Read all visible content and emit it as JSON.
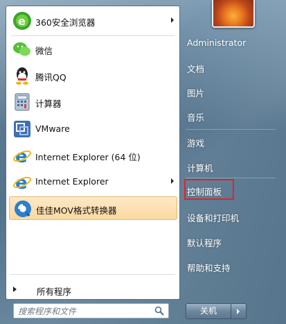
{
  "programs": [
    {
      "label": "360安全浏览器",
      "icon": "360-browser-icon",
      "has_submenu": true
    },
    {
      "label": "微信",
      "icon": "wechat-icon",
      "has_submenu": false
    },
    {
      "label": "腾讯QQ",
      "icon": "qq-icon",
      "has_submenu": false
    },
    {
      "label": "计算器",
      "icon": "calculator-icon",
      "has_submenu": false
    },
    {
      "label": "VMware",
      "icon": "vmware-icon",
      "has_submenu": false
    },
    {
      "label": "Internet Explorer (64 位)",
      "icon": "ie-icon",
      "has_submenu": false
    },
    {
      "label": "Internet Explorer",
      "icon": "ie-icon",
      "has_submenu": true
    },
    {
      "label": "佳佳MOV格式转换器",
      "icon": "mov-converter-icon",
      "has_submenu": false,
      "highlighted": true
    }
  ],
  "all_programs": "所有程序",
  "search": {
    "placeholder": "搜索程序和文件"
  },
  "right": {
    "user": "Administrator",
    "documents": "文档",
    "pictures": "图片",
    "music": "音乐",
    "games": "游戏",
    "computer": "计算机",
    "control_panel": "控制面板",
    "devices": "设备和打印机",
    "default_programs": "默认程序",
    "help": "帮助和支持"
  },
  "shutdown": {
    "label": "关机"
  },
  "colors": {
    "highlight_box": "#e0232a",
    "menu_bg": "#5b7b93"
  }
}
